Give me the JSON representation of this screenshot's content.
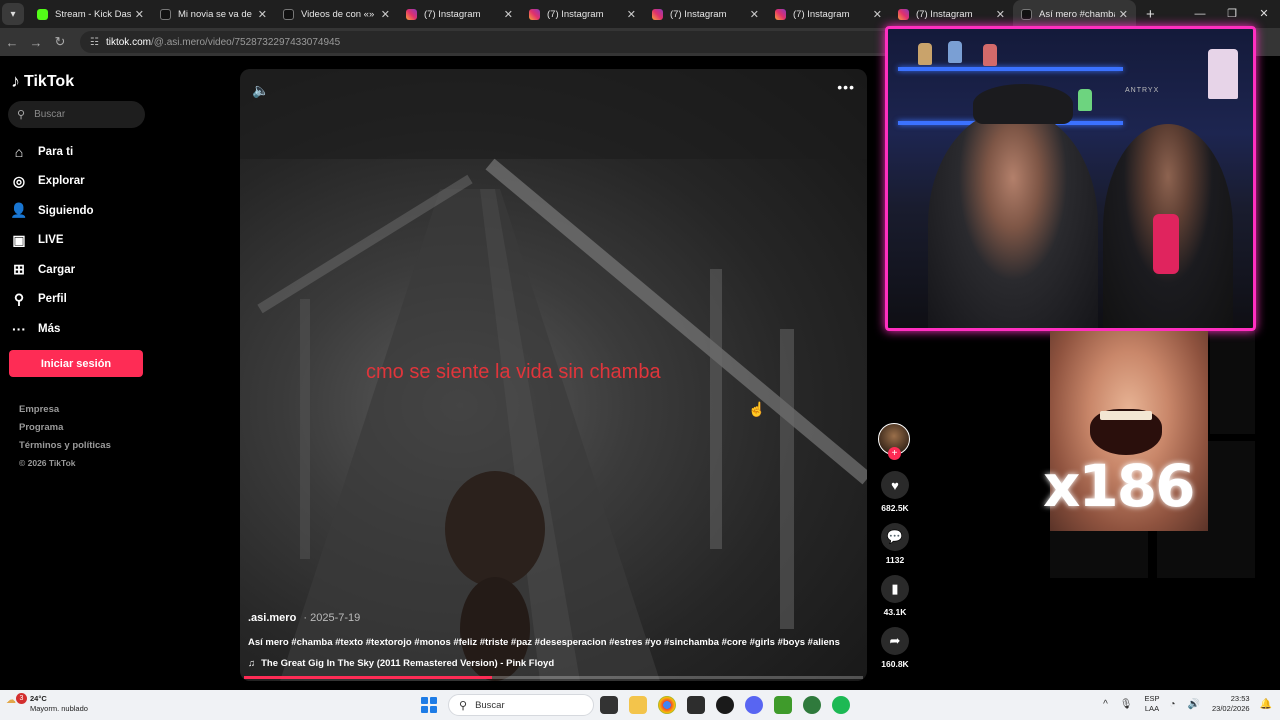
{
  "browser": {
    "tabs": [
      {
        "title": "Stream - Kick Dashboard",
        "favicon": "kick-icon",
        "active": false
      },
      {
        "title": "Mi novia se va de viaje",
        "favicon": "tiktok-icon",
        "active": false
      },
      {
        "title": "Videos de con «» | TikTok",
        "favicon": "tiktok-icon",
        "active": false
      },
      {
        "title": "(7) Instagram",
        "favicon": "instagram-icon",
        "active": false
      },
      {
        "title": "(7) Instagram",
        "favicon": "instagram-icon",
        "active": false
      },
      {
        "title": "(7) Instagram",
        "favicon": "instagram-icon",
        "active": false
      },
      {
        "title": "(7) Instagram",
        "favicon": "instagram-icon",
        "active": false
      },
      {
        "title": "(7) Instagram",
        "favicon": "instagram-icon",
        "active": false
      },
      {
        "title": "Así mero #chamba",
        "favicon": "tiktok-icon",
        "active": true
      }
    ],
    "url_host": "tiktok.com",
    "url_path": "/@.asi.mero/video/7528732297433074945"
  },
  "tiktok": {
    "logo": "TikTok",
    "search_placeholder": "Buscar",
    "nav": [
      {
        "label": "Para ti",
        "icon": "home-icon",
        "glyph": "⌂"
      },
      {
        "label": "Explorar",
        "icon": "compass-icon",
        "glyph": "◎"
      },
      {
        "label": "Siguiendo",
        "icon": "following-icon",
        "glyph": "👤"
      },
      {
        "label": "LIVE",
        "icon": "live-icon",
        "glyph": "▣"
      },
      {
        "label": "Cargar",
        "icon": "upload-icon",
        "glyph": "⊞"
      },
      {
        "label": "Perfil",
        "icon": "profile-icon",
        "glyph": "⚲"
      },
      {
        "label": "Más",
        "icon": "more-icon",
        "glyph": "···"
      }
    ],
    "login_label": "Iniciar sesión",
    "footer": [
      "Empresa",
      "Programa",
      "Términos y políticas"
    ],
    "copyright": "© 2026 TikTok"
  },
  "video": {
    "overlay_text": "cmo se siente la vida sin chamba",
    "username": ".asi.mero",
    "date": "2025-7-19",
    "description": "Así mero #chamba #texto #textorojo #monos #feliz #triste #paz #desesperacion #estres #yo #sinchamba #core #girls #boys #aliens",
    "music": "The Great Gig In The Sky (2011 Remastered Version) - Pink Floyd",
    "progress": 0.4,
    "likes": "682.5K",
    "comments": "1132",
    "saves": "43.1K",
    "shares": "160.8K"
  },
  "overlay": {
    "chair_brand": "ANTRYX",
    "meme_counter": "x186",
    "accent_color": "#ff2fc0"
  },
  "taskbar": {
    "weather_temp": "24°C",
    "weather_desc": "Mayorm. nublado",
    "weather_badge": "3",
    "search_label": "Buscar",
    "lang_top": "ESP",
    "lang_bottom": "LAA",
    "time": "23:53",
    "date": "23/02/2026"
  }
}
